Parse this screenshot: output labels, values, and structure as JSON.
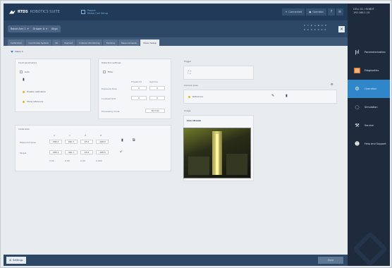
{
  "header": {
    "logo_text": "RTDS",
    "logo_sub": "ROBOTICS SUITE",
    "project_line1": "Project",
    "project_line2": "Demo Cell Setup",
    "btn_connect": "Connected",
    "btn_user": "Operator",
    "btn_help": "?",
    "btn_settings": "≡"
  },
  "subbar": {
    "robot_label": "Robot Arm 1",
    "tool_label": "Gripper A",
    "mode_label": "Align",
    "axes_row1": [
      "X",
      "Y",
      "Z",
      "A",
      "B",
      "C",
      "E"
    ],
    "axes_row2": [
      "0",
      "0",
      "0",
      "0",
      "0",
      "0",
      "0"
    ],
    "close_label": "×"
  },
  "tabs": [
    "Calibration",
    "Coordinate System",
    "I/O",
    "Payload",
    "Collision Monitoring",
    "Tracking",
    "Measurements",
    "Vision Setup"
  ],
  "active_tab_index": 7,
  "content": {
    "section_toggle": "Vision 1",
    "panel_left_title": "Input parameters",
    "panel_left_items": {
      "radio_label": "Auto",
      "status1": "Enable calibration",
      "status2": "Show reference"
    },
    "panel_mid_title": "Detection settings",
    "panel_mid_items": {
      "check_label": "Filter",
      "col1": "Threshold",
      "col2": "Gamma",
      "row1_label": "Exposure time",
      "row1_v1": "0",
      "row1_v2": "0",
      "row2_label": "Contrast limit",
      "row2_v1": "0",
      "row2_v2": "0",
      "row3_label": "Processing mode",
      "row3_v": "Normal"
    },
    "panel_bottom_title": "Calibration",
    "panel_bottom": {
      "headers": [
        "X",
        "Y",
        "Z",
        "R"
      ],
      "row1_label": "Measured pose",
      "row1": [
        "268.4",
        "460.7",
        "95.6",
        "-168.9"
      ],
      "row2_label": "Target",
      "row2": [
        "268.4",
        "460.7",
        "95.6",
        "-168.9"
      ],
      "row3": [
        "0.00",
        "0.00",
        "0.00",
        "0.000"
      ]
    },
    "panel_right_title1": "Trigger",
    "panel_right_title2": "Camera pose",
    "camera_pose_value": "Reference",
    "image_title": "Image",
    "image_caption": "Live stream"
  },
  "footer": {
    "left_button": "Settings",
    "right_button": "Save"
  },
  "sidebar": {
    "head_line1": "CELL 01 / ROBOT",
    "head_line2": "192.168.1.10",
    "items": [
      "Parameterization",
      "Diagnostics",
      "Operation",
      "Simulation",
      "Service",
      "Help and Support"
    ],
    "active_index": 2
  },
  "colors": {
    "header": "#203a58",
    "accent": "#2f86c8",
    "status_dot": "#e0b81e",
    "sidebar": "#1e2b3c"
  }
}
